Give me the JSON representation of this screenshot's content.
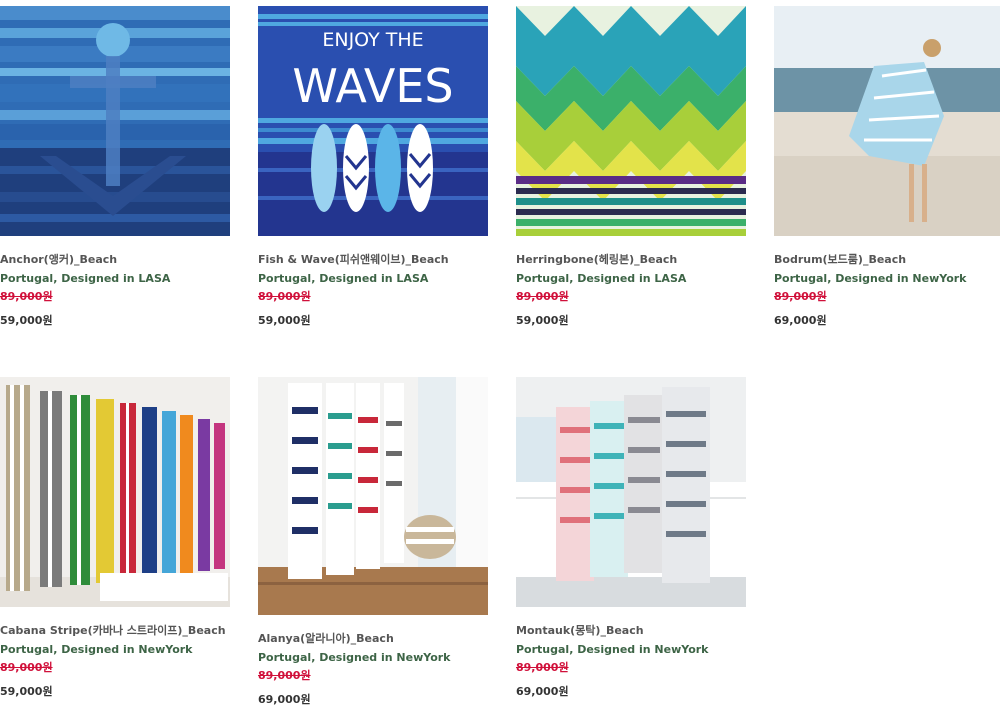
{
  "products": [
    {
      "name": "Anchor(앵커)_Beach",
      "origin": "Portugal, Designed in LASA",
      "original_price": "89,000원",
      "price": "59,000원",
      "image": "anchor-towel"
    },
    {
      "name": "Fish & Wave(피쉬앤웨이브)_Beach",
      "origin": "Portugal, Designed in LASA",
      "original_price": "89,000원",
      "price": "59,000원",
      "image": "surfboard-towel",
      "image_text": [
        "ENJOY THE",
        "WAVES"
      ]
    },
    {
      "name": "Herringbone(헤링본)_Beach",
      "origin": "Portugal, Designed in LASA",
      "original_price": "89,000원",
      "price": "59,000원",
      "image": "herringbone-towel"
    },
    {
      "name": "Bodrum(보드룸)_Beach",
      "origin": "Portugal, Designed in NewYork",
      "original_price": "89,000원",
      "price": "69,000원",
      "image": "beach-woman-photo"
    },
    {
      "name": "Cabana Stripe(카바나 스트라이프)_Beach",
      "origin": "Portugal, Designed in NewYork",
      "original_price": "89,000원",
      "price": "59,000원",
      "image": "cabana-towels-photo"
    },
    {
      "name": "Alanya(알라니아)_Beach",
      "origin": "Portugal, Designed in NewYork",
      "original_price": "89,000원",
      "price": "69,000원",
      "image": "alanya-towels-photo"
    },
    {
      "name": "Montauk(몽탁)_Beach",
      "origin": "Portugal, Designed in NewYork",
      "original_price": "89,000원",
      "price": "69,000원",
      "image": "montauk-towels-photo"
    }
  ],
  "colors": {
    "origin_text": "#3d6446",
    "old_price": "#d0103a",
    "name_text": "#555555"
  }
}
